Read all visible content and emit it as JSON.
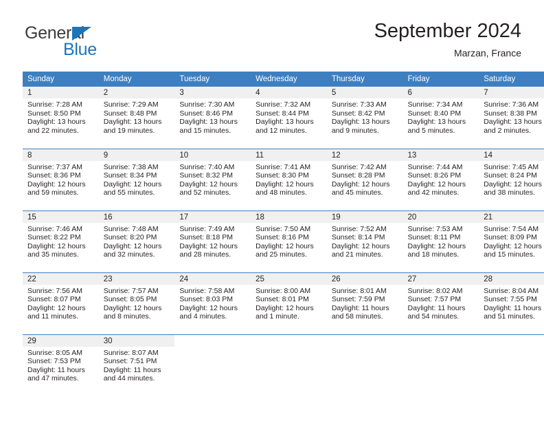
{
  "brand": {
    "name_part1": "General",
    "name_part2": "Blue",
    "accent_color": "#1b75bb",
    "triangle_icon": "triangle-icon"
  },
  "header": {
    "title": "September 2024",
    "location": "Marzan, France"
  },
  "calendar": {
    "header_bg": "#3d7fc1",
    "daynum_bg": "#f0f0f0",
    "weekdays": [
      "Sunday",
      "Monday",
      "Tuesday",
      "Wednesday",
      "Thursday",
      "Friday",
      "Saturday"
    ],
    "weeks": [
      [
        {
          "day": "1",
          "sunrise": "Sunrise: 7:28 AM",
          "sunset": "Sunset: 8:50 PM",
          "daylight": "Daylight: 13 hours and 22 minutes."
        },
        {
          "day": "2",
          "sunrise": "Sunrise: 7:29 AM",
          "sunset": "Sunset: 8:48 PM",
          "daylight": "Daylight: 13 hours and 19 minutes."
        },
        {
          "day": "3",
          "sunrise": "Sunrise: 7:30 AM",
          "sunset": "Sunset: 8:46 PM",
          "daylight": "Daylight: 13 hours and 15 minutes."
        },
        {
          "day": "4",
          "sunrise": "Sunrise: 7:32 AM",
          "sunset": "Sunset: 8:44 PM",
          "daylight": "Daylight: 13 hours and 12 minutes."
        },
        {
          "day": "5",
          "sunrise": "Sunrise: 7:33 AM",
          "sunset": "Sunset: 8:42 PM",
          "daylight": "Daylight: 13 hours and 9 minutes."
        },
        {
          "day": "6",
          "sunrise": "Sunrise: 7:34 AM",
          "sunset": "Sunset: 8:40 PM",
          "daylight": "Daylight: 13 hours and 5 minutes."
        },
        {
          "day": "7",
          "sunrise": "Sunrise: 7:36 AM",
          "sunset": "Sunset: 8:38 PM",
          "daylight": "Daylight: 13 hours and 2 minutes."
        }
      ],
      [
        {
          "day": "8",
          "sunrise": "Sunrise: 7:37 AM",
          "sunset": "Sunset: 8:36 PM",
          "daylight": "Daylight: 12 hours and 59 minutes."
        },
        {
          "day": "9",
          "sunrise": "Sunrise: 7:38 AM",
          "sunset": "Sunset: 8:34 PM",
          "daylight": "Daylight: 12 hours and 55 minutes."
        },
        {
          "day": "10",
          "sunrise": "Sunrise: 7:40 AM",
          "sunset": "Sunset: 8:32 PM",
          "daylight": "Daylight: 12 hours and 52 minutes."
        },
        {
          "day": "11",
          "sunrise": "Sunrise: 7:41 AM",
          "sunset": "Sunset: 8:30 PM",
          "daylight": "Daylight: 12 hours and 48 minutes."
        },
        {
          "day": "12",
          "sunrise": "Sunrise: 7:42 AM",
          "sunset": "Sunset: 8:28 PM",
          "daylight": "Daylight: 12 hours and 45 minutes."
        },
        {
          "day": "13",
          "sunrise": "Sunrise: 7:44 AM",
          "sunset": "Sunset: 8:26 PM",
          "daylight": "Daylight: 12 hours and 42 minutes."
        },
        {
          "day": "14",
          "sunrise": "Sunrise: 7:45 AM",
          "sunset": "Sunset: 8:24 PM",
          "daylight": "Daylight: 12 hours and 38 minutes."
        }
      ],
      [
        {
          "day": "15",
          "sunrise": "Sunrise: 7:46 AM",
          "sunset": "Sunset: 8:22 PM",
          "daylight": "Daylight: 12 hours and 35 minutes."
        },
        {
          "day": "16",
          "sunrise": "Sunrise: 7:48 AM",
          "sunset": "Sunset: 8:20 PM",
          "daylight": "Daylight: 12 hours and 32 minutes."
        },
        {
          "day": "17",
          "sunrise": "Sunrise: 7:49 AM",
          "sunset": "Sunset: 8:18 PM",
          "daylight": "Daylight: 12 hours and 28 minutes."
        },
        {
          "day": "18",
          "sunrise": "Sunrise: 7:50 AM",
          "sunset": "Sunset: 8:16 PM",
          "daylight": "Daylight: 12 hours and 25 minutes."
        },
        {
          "day": "19",
          "sunrise": "Sunrise: 7:52 AM",
          "sunset": "Sunset: 8:14 PM",
          "daylight": "Daylight: 12 hours and 21 minutes."
        },
        {
          "day": "20",
          "sunrise": "Sunrise: 7:53 AM",
          "sunset": "Sunset: 8:11 PM",
          "daylight": "Daylight: 12 hours and 18 minutes."
        },
        {
          "day": "21",
          "sunrise": "Sunrise: 7:54 AM",
          "sunset": "Sunset: 8:09 PM",
          "daylight": "Daylight: 12 hours and 15 minutes."
        }
      ],
      [
        {
          "day": "22",
          "sunrise": "Sunrise: 7:56 AM",
          "sunset": "Sunset: 8:07 PM",
          "daylight": "Daylight: 12 hours and 11 minutes."
        },
        {
          "day": "23",
          "sunrise": "Sunrise: 7:57 AM",
          "sunset": "Sunset: 8:05 PM",
          "daylight": "Daylight: 12 hours and 8 minutes."
        },
        {
          "day": "24",
          "sunrise": "Sunrise: 7:58 AM",
          "sunset": "Sunset: 8:03 PM",
          "daylight": "Daylight: 12 hours and 4 minutes."
        },
        {
          "day": "25",
          "sunrise": "Sunrise: 8:00 AM",
          "sunset": "Sunset: 8:01 PM",
          "daylight": "Daylight: 12 hours and 1 minute."
        },
        {
          "day": "26",
          "sunrise": "Sunrise: 8:01 AM",
          "sunset": "Sunset: 7:59 PM",
          "daylight": "Daylight: 11 hours and 58 minutes."
        },
        {
          "day": "27",
          "sunrise": "Sunrise: 8:02 AM",
          "sunset": "Sunset: 7:57 PM",
          "daylight": "Daylight: 11 hours and 54 minutes."
        },
        {
          "day": "28",
          "sunrise": "Sunrise: 8:04 AM",
          "sunset": "Sunset: 7:55 PM",
          "daylight": "Daylight: 11 hours and 51 minutes."
        }
      ],
      [
        {
          "day": "29",
          "sunrise": "Sunrise: 8:05 AM",
          "sunset": "Sunset: 7:53 PM",
          "daylight": "Daylight: 11 hours and 47 minutes."
        },
        {
          "day": "30",
          "sunrise": "Sunrise: 8:07 AM",
          "sunset": "Sunset: 7:51 PM",
          "daylight": "Daylight: 11 hours and 44 minutes."
        },
        {
          "day": "",
          "sunrise": "",
          "sunset": "",
          "daylight": ""
        },
        {
          "day": "",
          "sunrise": "",
          "sunset": "",
          "daylight": ""
        },
        {
          "day": "",
          "sunrise": "",
          "sunset": "",
          "daylight": ""
        },
        {
          "day": "",
          "sunrise": "",
          "sunset": "",
          "daylight": ""
        },
        {
          "day": "",
          "sunrise": "",
          "sunset": "",
          "daylight": ""
        }
      ]
    ]
  }
}
